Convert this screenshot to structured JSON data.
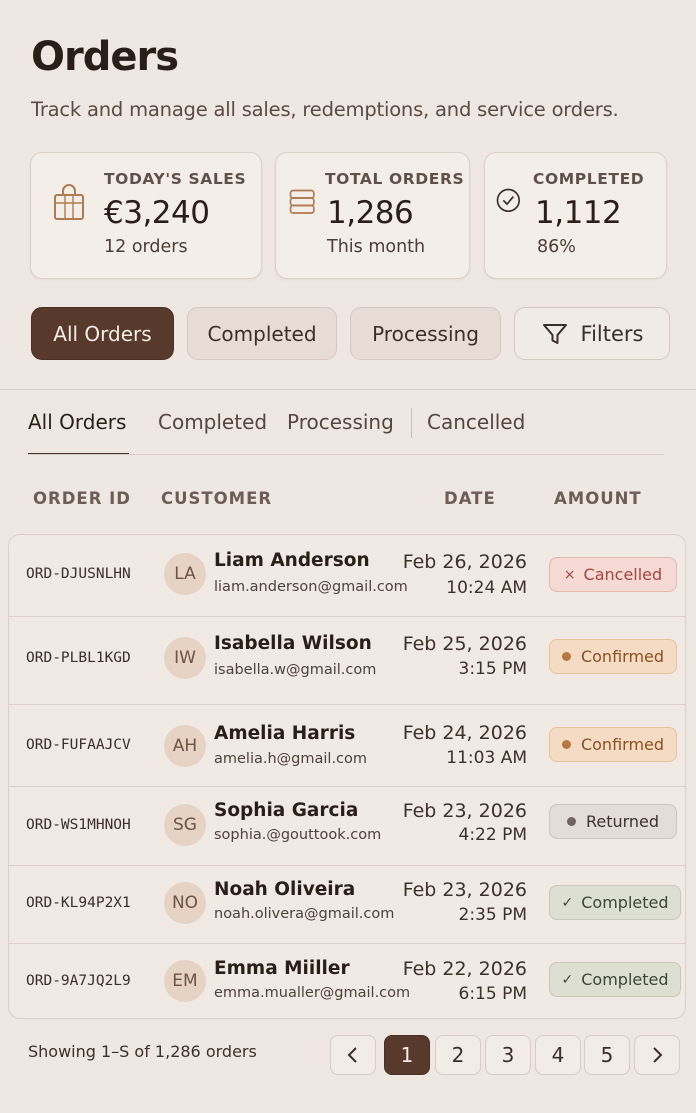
{
  "page": {
    "title": "Orders",
    "subtitle": "Track and manage all sales, redemptions, and service orders."
  },
  "stats": [
    {
      "label": "TODAY'S SALES",
      "value": "€3,240",
      "sub": "12 orders",
      "icon": "shopping-bag-icon"
    },
    {
      "label": "TOTAL ORDERS",
      "value": "1,286",
      "sub": "This month",
      "icon": "stack-icon"
    },
    {
      "label": "COMPLETED",
      "value": "1,112",
      "sub": "86%",
      "icon": "check-circle-icon"
    }
  ],
  "chips": {
    "all": "All Orders",
    "completed": "Completed",
    "processing": "Processing",
    "filters": "Filters"
  },
  "tabs": [
    "All Orders",
    "Completed",
    "Processing",
    "Cancelled"
  ],
  "table": {
    "headers": {
      "order_id": "ORDER ID",
      "customer": "CUSTOMER",
      "date": "DATE",
      "amount": "AMOUNT"
    },
    "rows": [
      {
        "id": "ORD-DJUSNLHN",
        "initials": "LA",
        "name": "Liam Anderson",
        "email": "liam.anderson@gmail.com",
        "date": "Feb 26, 2026",
        "time": "10:24 AM",
        "status": "Cancelled",
        "status_icon": "×"
      },
      {
        "id": "ORD-PLBL1KGD",
        "initials": "IW",
        "name": "Isabella Wilson",
        "email": "isabella.w@gmail.com",
        "date": "Feb 25, 2026",
        "time": "3:15 PM",
        "status": "Confirmed",
        "status_icon": "dot"
      },
      {
        "id": "ORD-FUFAAJCV",
        "initials": "AH",
        "name": "Amelia Harris",
        "email": "amelia.h@gmail.com",
        "date": "Feb 24, 2026",
        "time": "11:03 AM",
        "status": "Confirmed",
        "status_icon": "dot"
      },
      {
        "id": "ORD-WS1MHNOH",
        "initials": "SG",
        "name": "Sophia Garcia",
        "email": "sophia.@gouttook.com",
        "date": "Feb 23, 2026",
        "time": "4:22 PM",
        "status": "Returned",
        "status_icon": "dot"
      },
      {
        "id": "ORD-KL94P2X1",
        "initials": "NO",
        "name": "Noah Oliveira",
        "email": "noah.olivera@gmail.com",
        "date": "Feb 23, 2026",
        "time": "2:35 PM",
        "status": "Completed",
        "status_icon": "✓"
      },
      {
        "id": "ORD-9A7JQ2L9",
        "initials": "EM",
        "name": "Emma Miiller",
        "email": "emma.mualler@gmail.com",
        "date": "Feb 22, 2026",
        "time": "6:15 PM",
        "status": "Completed",
        "status_icon": "✓"
      }
    ]
  },
  "pagination": {
    "summary": "Showing 1–S of 1,286 orders",
    "prev": "‹",
    "next": "›",
    "pages": [
      "1",
      "2",
      "3",
      "4",
      "5"
    ],
    "current": "1"
  },
  "colors": {
    "accent": "#573a2b",
    "cancelled": "#a3463c",
    "confirmed": "#8c4f1f",
    "completed": "#3d4535"
  }
}
